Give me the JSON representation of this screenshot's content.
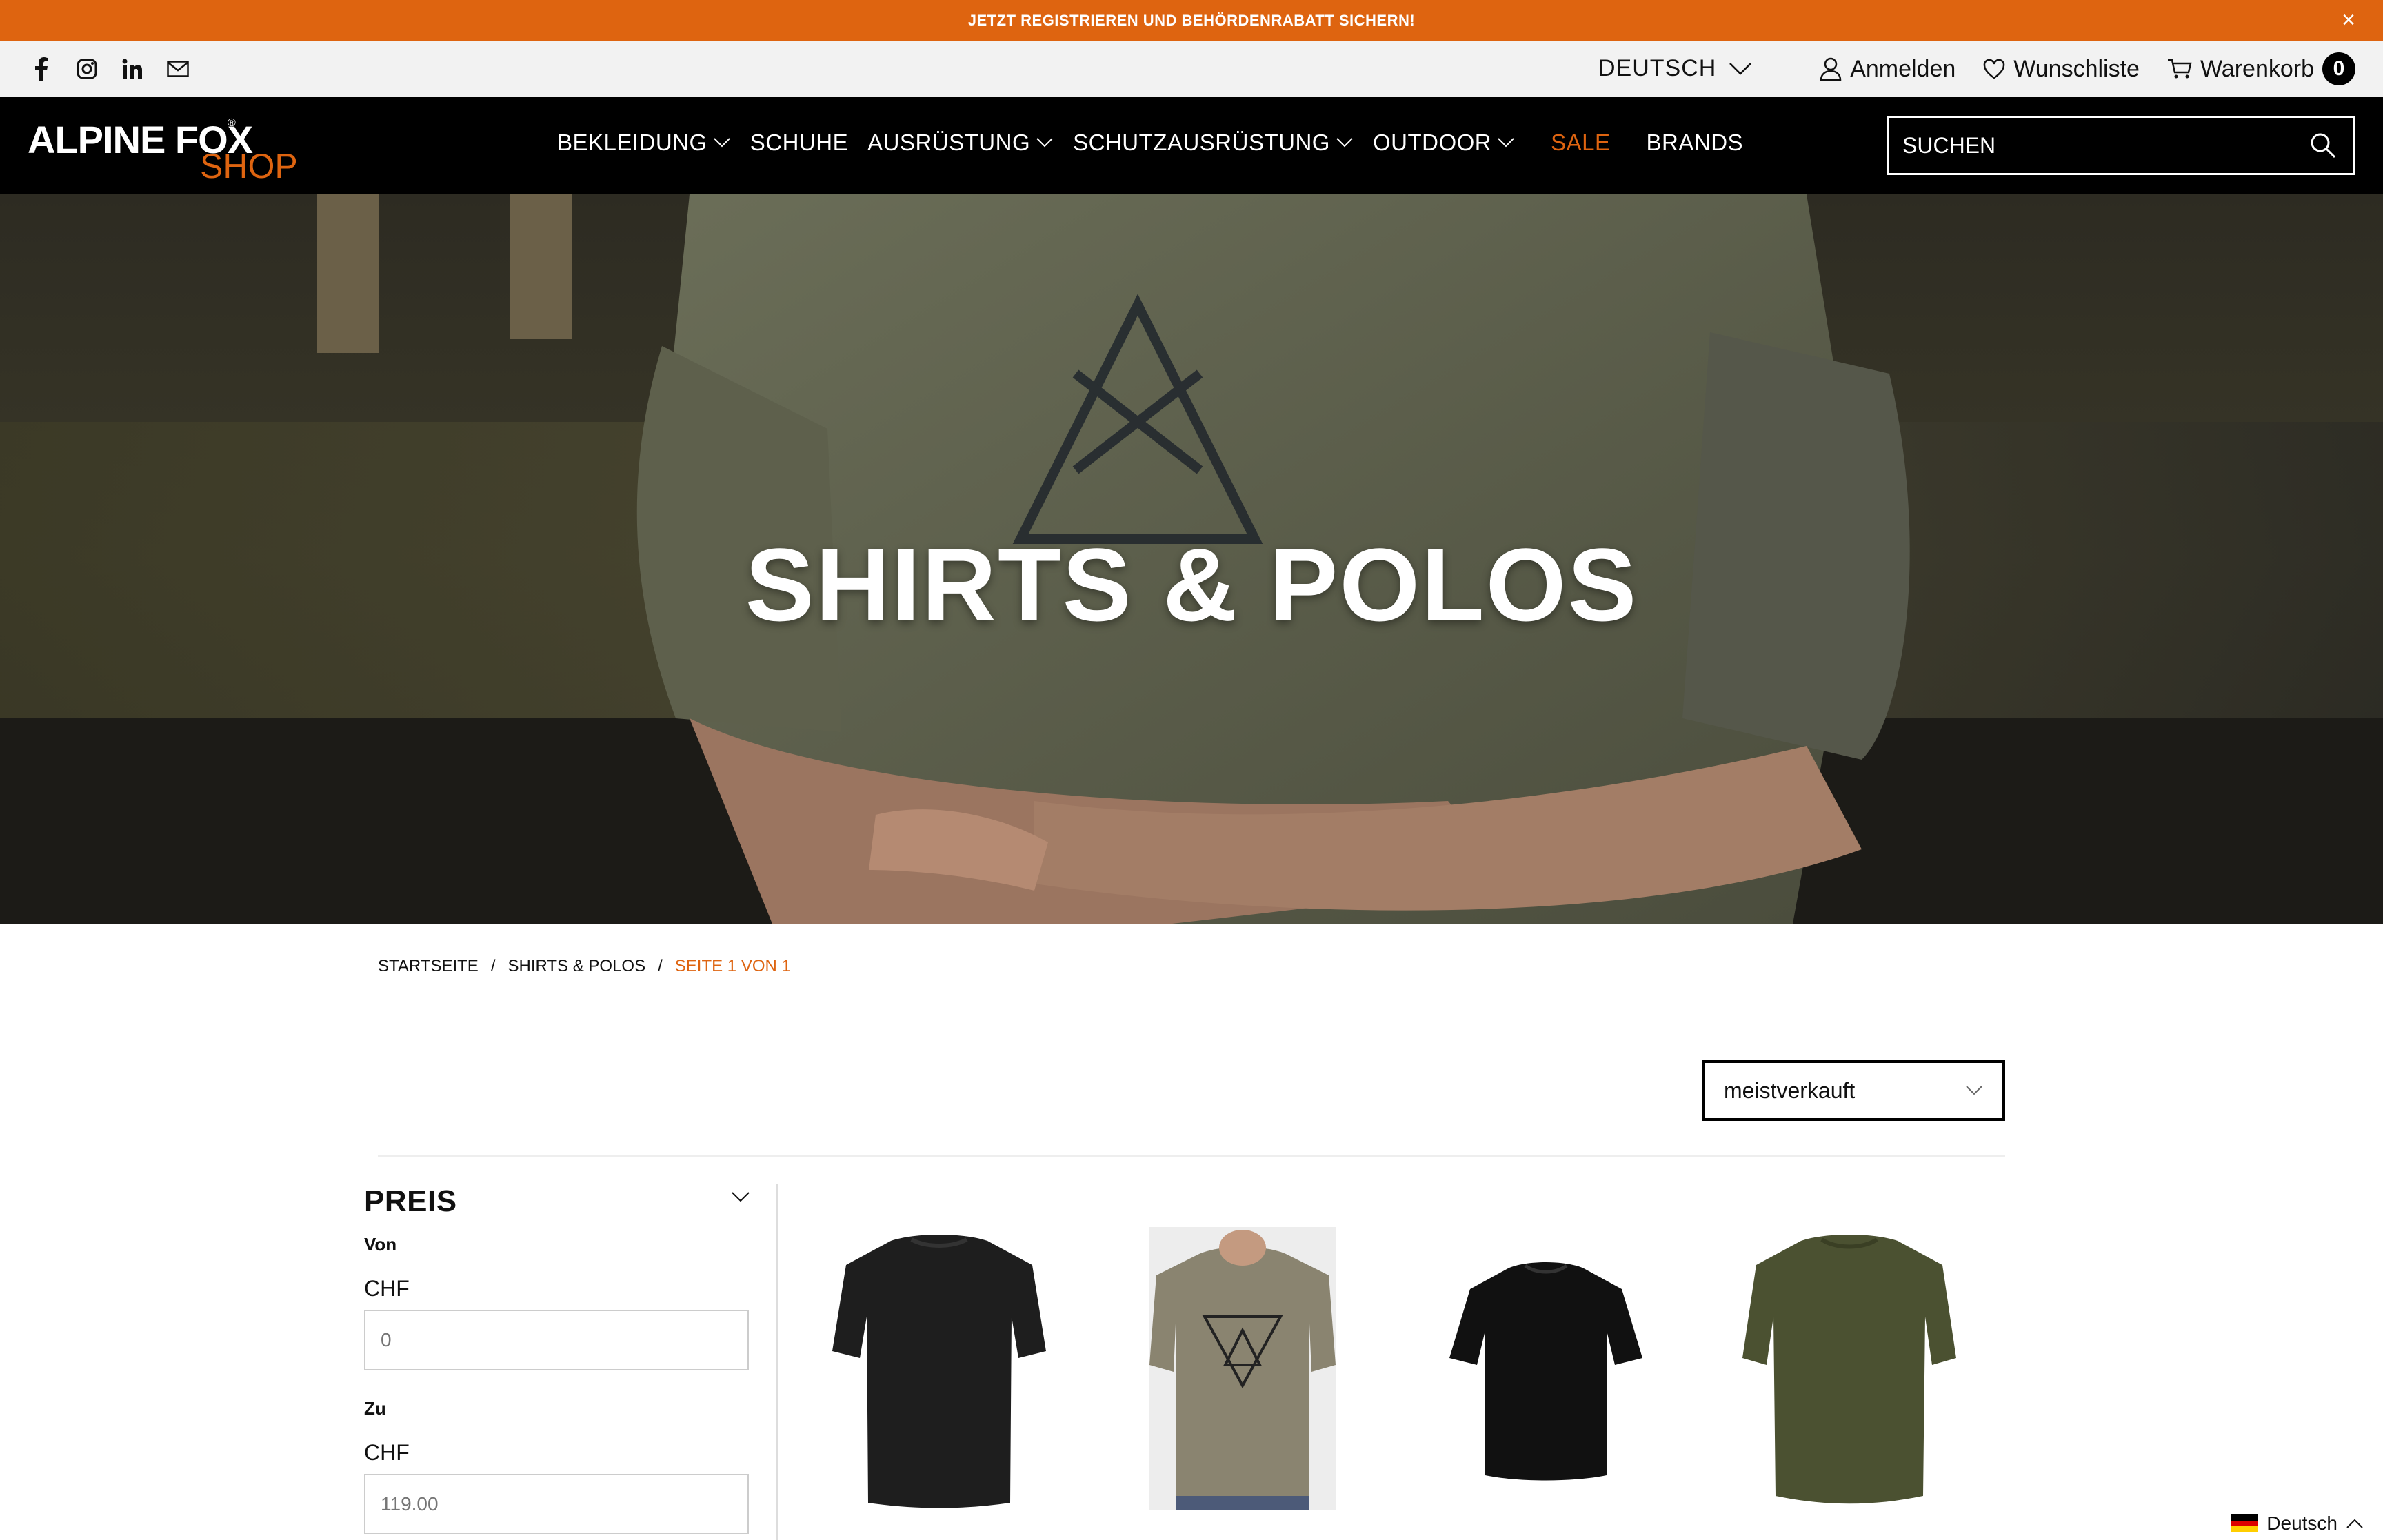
{
  "promo": {
    "text": "JETZT REGISTRIEREN UND BEHÖRDENRABATT SICHERN!",
    "close": "×"
  },
  "utility": {
    "language": "DEUTSCH",
    "login": "Anmelden",
    "wishlist": "Wunschliste",
    "cart": "Warenkorb",
    "cart_count": "0"
  },
  "header": {
    "logo_main": "ALPINE FOX",
    "logo_reg": "®",
    "logo_sub": "SHOP",
    "nav": [
      {
        "label": "BEKLEIDUNG",
        "dropdown": true
      },
      {
        "label": "SCHUHE",
        "dropdown": false
      },
      {
        "label": "AUSRÜSTUNG",
        "dropdown": true
      },
      {
        "label": "SCHUTZAUSRÜSTUNG",
        "dropdown": true
      },
      {
        "label": "OUTDOOR",
        "dropdown": true
      },
      {
        "label": "SALE",
        "dropdown": false
      },
      {
        "label": "BRANDS",
        "dropdown": false
      }
    ],
    "search_placeholder": "SUCHEN"
  },
  "hero": {
    "title": "SHIRTS & POLOS"
  },
  "breadcrumb": {
    "home": "STARTSEITE",
    "sep": "/",
    "category": "SHIRTS & POLOS",
    "current": "SEITE 1 VON 1"
  },
  "sort": {
    "selected": "meistverkauft"
  },
  "filter": {
    "title": "PREIS",
    "from_label": "Von",
    "to_label": "Zu",
    "currency": "CHF",
    "from_placeholder": "0",
    "to_placeholder": "119.00"
  },
  "products": [
    {
      "name": "black-raglan-tshirt"
    },
    {
      "name": "olive-graphic-tshirt"
    },
    {
      "name": "black-tshirt"
    },
    {
      "name": "olive-raglan-tshirt"
    }
  ],
  "lang_widget": {
    "label": "Deutsch"
  },
  "colors": {
    "accent": "#de6410",
    "header_bg": "#000000",
    "utility_bg": "#f2f2f2"
  }
}
